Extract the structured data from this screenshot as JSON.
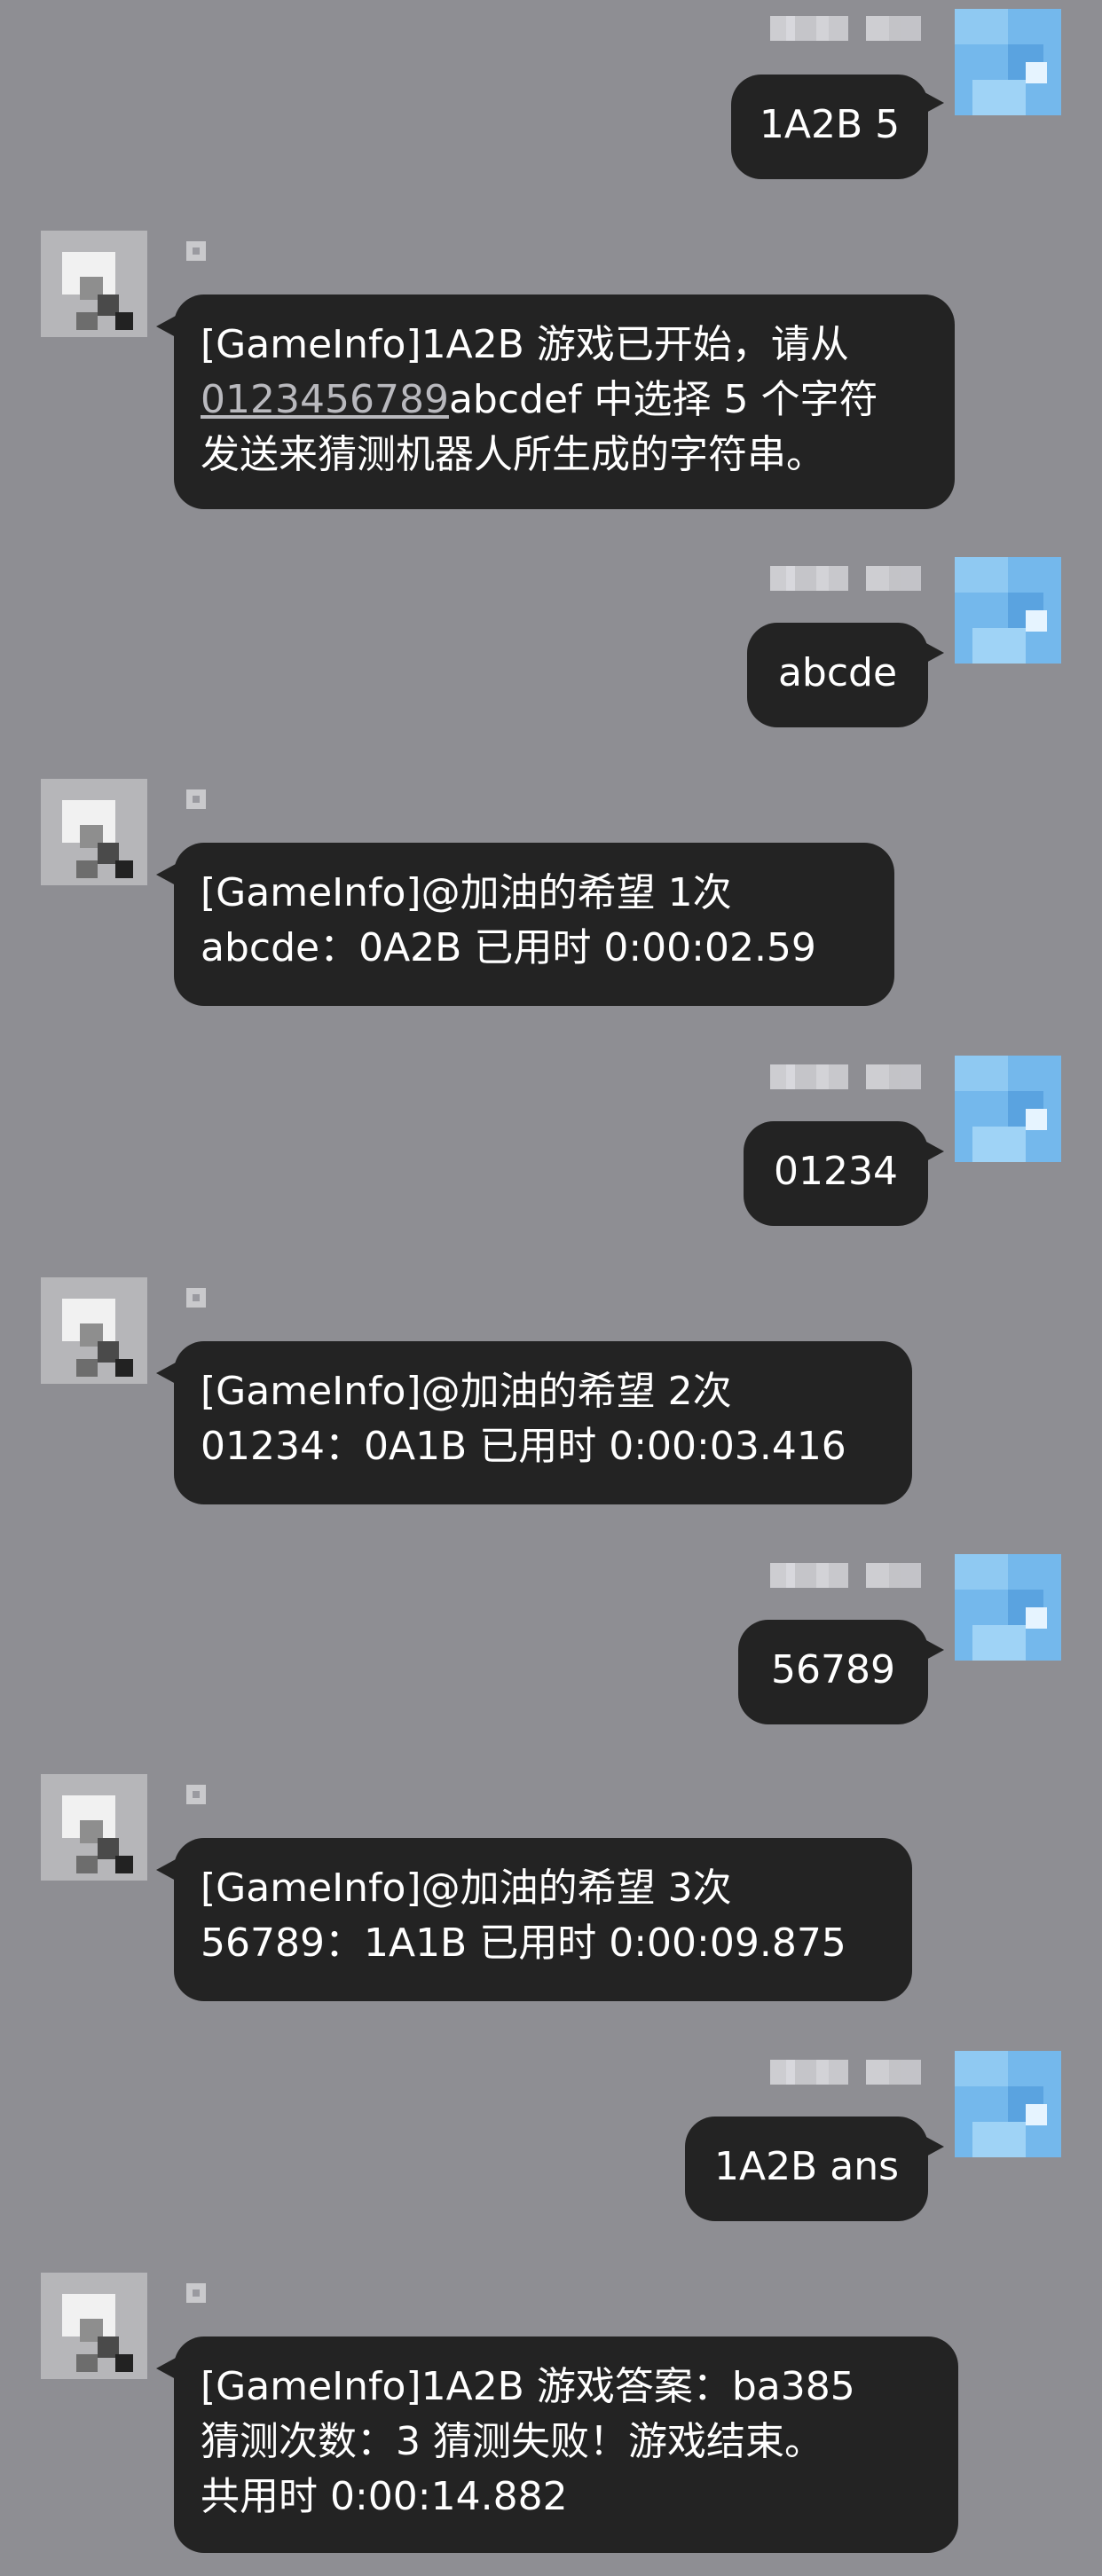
{
  "messages": [
    {
      "side": "right",
      "text": "1A2B 5"
    },
    {
      "side": "left",
      "lines": [
        "[GameInfo]1A2B 游戏已开始，请从",
        "abcdef 中选择 5 个字符",
        "发送来猜测机器人所生成的字符串。"
      ],
      "link": "0123456789"
    },
    {
      "side": "right",
      "text": "abcde"
    },
    {
      "side": "left",
      "lines": [
        "[GameInfo]@加油的希望 1次",
        "abcde：0A2B 已用时 0:00:02.59"
      ]
    },
    {
      "side": "right",
      "text": "01234"
    },
    {
      "side": "left",
      "lines": [
        "[GameInfo]@加油的希望 2次",
        "01234：0A1B 已用时 0:00:03.416"
      ]
    },
    {
      "side": "right",
      "text": "56789"
    },
    {
      "side": "left",
      "lines": [
        "[GameInfo]@加油的希望 3次",
        "56789：1A1B 已用时 0:00:09.875"
      ]
    },
    {
      "side": "right",
      "text": "1A2B ans"
    },
    {
      "side": "left",
      "lines": [
        "[GameInfo]1A2B 游戏答案：ba385",
        "猜测次数：3 猜测失败！游戏结束。",
        "共用时 0:00:14.882"
      ]
    }
  ],
  "colors": {
    "background": "#8e8e93",
    "bubble": "#232323",
    "text": "#ffffff",
    "link": "#b9b9be"
  },
  "icons": {
    "user_avatar": "pixelated-blue-avatar-icon",
    "bot_avatar": "pixelated-gray-avatar-icon"
  }
}
